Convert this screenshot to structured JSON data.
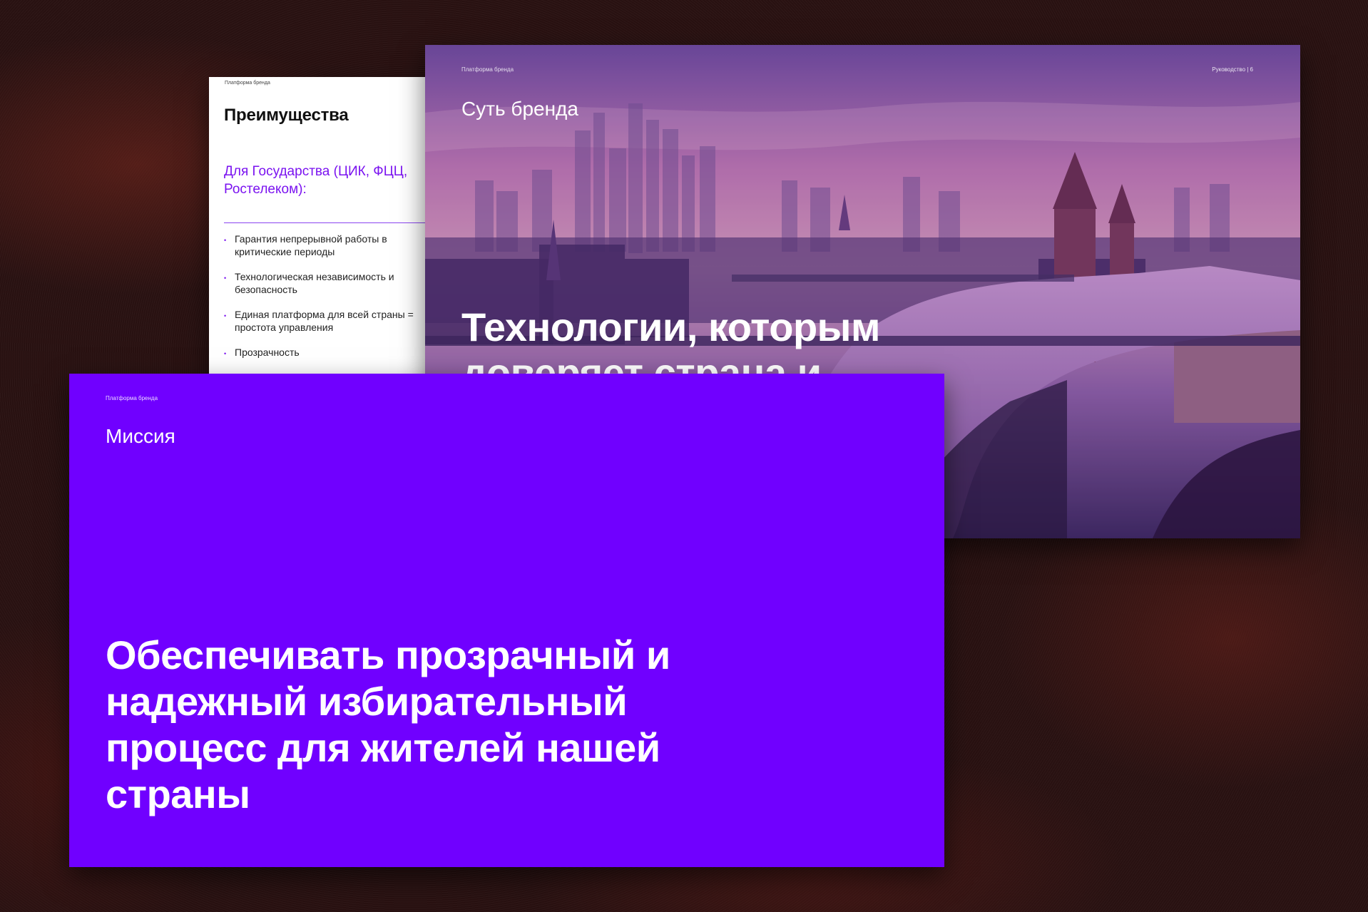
{
  "slide_advantages": {
    "tag": "Платформа бренда",
    "title": "Преимущества",
    "subtitle": "Для Государства (ЦИК, ФЦЦ, Ростелеком):",
    "items": [
      "Гарантия непрерывной работы в критические периоды",
      "Технологическая независимость и безопасность",
      "Единая платформа для всей страны = простота управления",
      "Прозрачность"
    ]
  },
  "slide_essence": {
    "tag": "Платформа бренда",
    "guide_label": "Руководство  |  6",
    "title": "Суть бренда",
    "headline": "Технологии, которым доверяет страна и которые создают историю"
  },
  "slide_mission": {
    "tag": "Платформа бренда",
    "title": "Миссия",
    "headline": "Обеспечивать прозрачный и надежный избирательный процесс для жителей нашей страны"
  },
  "colors": {
    "brand_purple": "#7000ff",
    "accent_text": "#7a12f0",
    "background": "#2a1212"
  }
}
